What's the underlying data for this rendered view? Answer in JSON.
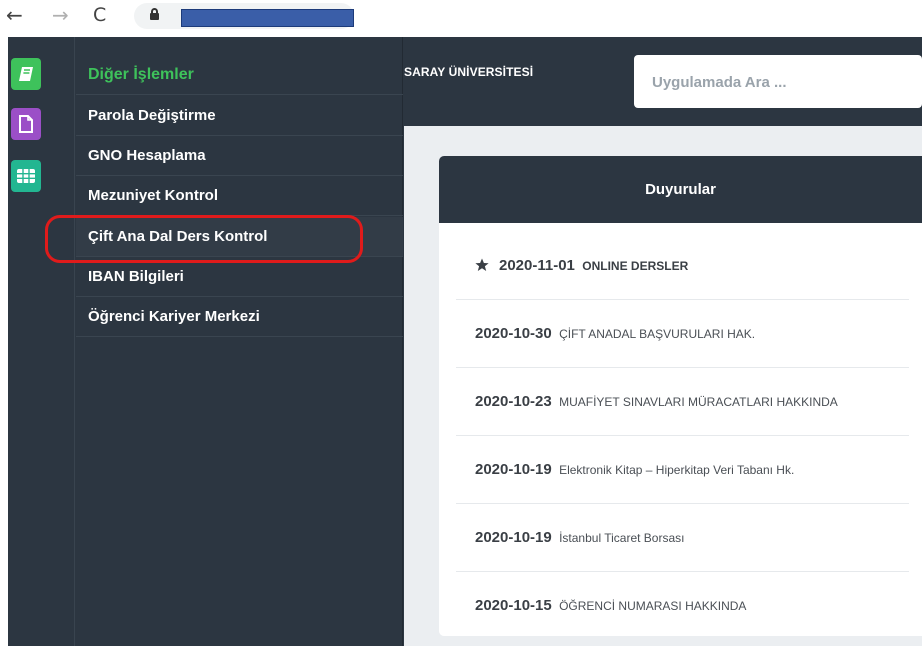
{
  "browser": {
    "back_icon": "arrow-left-icon",
    "forward_icon": "arrow-right-icon",
    "reload_icon": "reload-icon",
    "back_glyph": "←",
    "forward_glyph": "→",
    "reload_glyph": "C"
  },
  "icon_bar": {
    "items": [
      {
        "icon": "book-icon",
        "color": "#3ec25b"
      },
      {
        "icon": "document-icon",
        "color": "#9b4fc7"
      },
      {
        "icon": "grid-icon",
        "color": "#23b691"
      }
    ]
  },
  "menu": {
    "header": "Diğer İşlemler",
    "items": [
      {
        "label": "Parola Değiştirme"
      },
      {
        "label": "GNO Hesaplama"
      },
      {
        "label": "Mezuniyet Kontrol"
      },
      {
        "label": "Çift Ana Dal Ders Kontrol"
      },
      {
        "label": "IBAN Bilgileri"
      },
      {
        "label": "Öğrenci Kariyer Merkezi"
      }
    ]
  },
  "header": {
    "university": "SARAY ÜNİVERSİTESİ",
    "search_placeholder": "Uygulamada Ara ..."
  },
  "announcements": {
    "title": "Duyurular",
    "items": [
      {
        "date": "2020-11-01",
        "text": "ONLINE DERSLER",
        "pinned": true
      },
      {
        "date": "2020-10-30",
        "text": "ÇİFT ANADAL BAŞVURULARI HAK."
      },
      {
        "date": "2020-10-23",
        "text": "MUAFİYET SINAVLARI MÜRACATLARI HAKKINDA"
      },
      {
        "date": "2020-10-19",
        "text": "Elektronik Kitap – Hiperkitap Veri Tabanı Hk."
      },
      {
        "date": "2020-10-19",
        "text": "İstanbul Ticaret Borsası"
      },
      {
        "date": "2020-10-15",
        "text": "ÖĞRENCİ NUMARASI HAKKINDA"
      }
    ]
  },
  "colors": {
    "sidebar_bg": "#2c3641",
    "accent_green": "#3ec25b",
    "highlight_red": "#e01b1b",
    "content_bg": "#ebeef1"
  }
}
